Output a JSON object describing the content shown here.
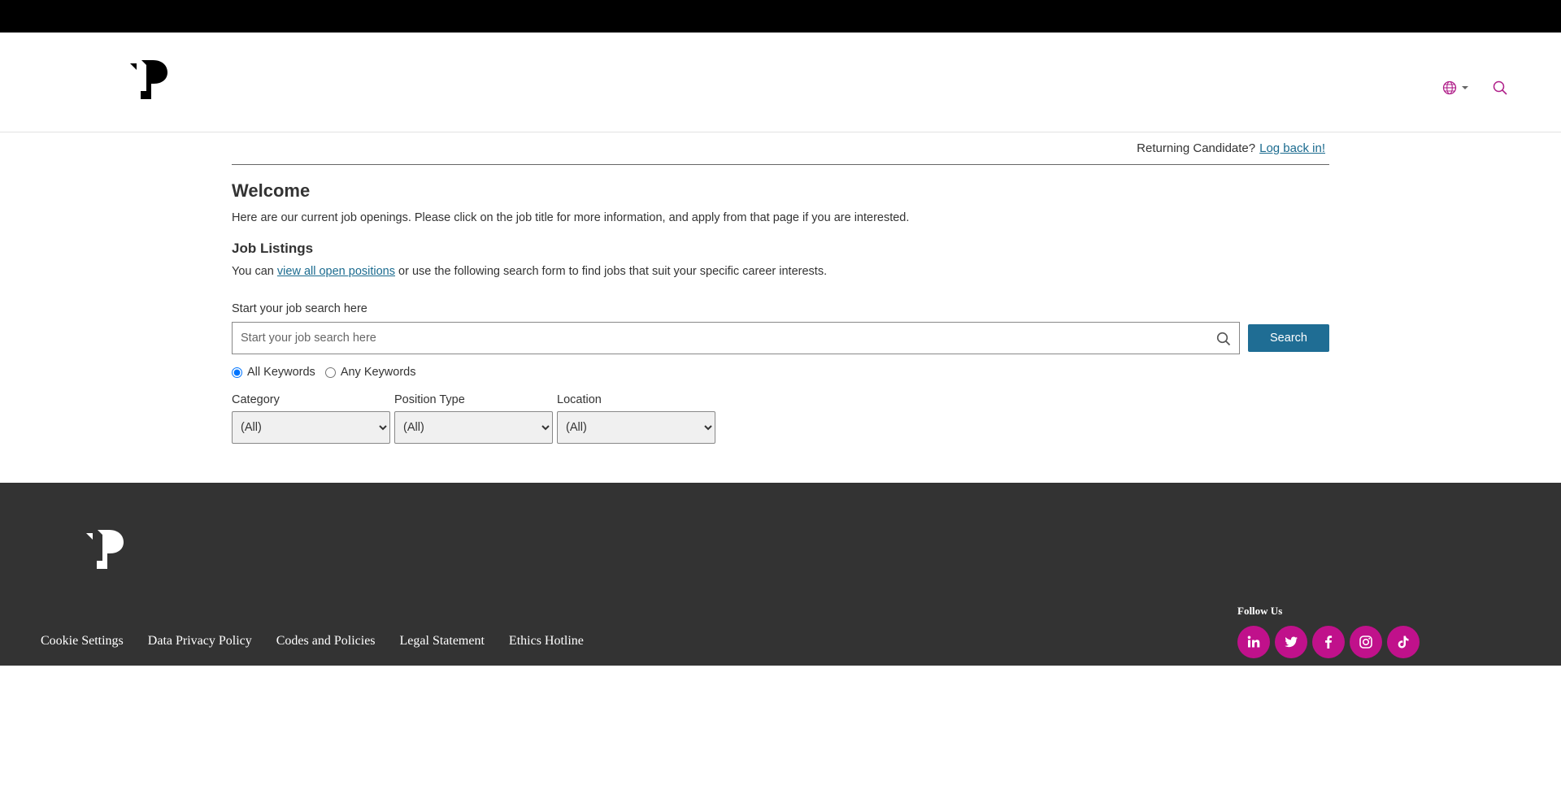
{
  "header": {
    "logo_icon": "p-logo-icon",
    "language_icon": "globe-icon",
    "search_icon": "search-icon"
  },
  "returning": {
    "text": "Returning Candidate?",
    "link": "Log back in!"
  },
  "welcome": {
    "title": "Welcome",
    "intro": "Here are our current job openings. Please click on the job title for more information, and apply from that page if you are interested."
  },
  "listings": {
    "title": "Job Listings",
    "prefix": "You can ",
    "link": "view all open positions",
    "suffix": " or use the following search form to find jobs that suit your specific career interests."
  },
  "search": {
    "label": "Start your job search here",
    "placeholder": "Start your job search here",
    "value": "",
    "button": "Search",
    "radio_all": "All Keywords",
    "radio_any": "Any Keywords",
    "selected": "all"
  },
  "filters": [
    {
      "label": "Category",
      "value": "(All)"
    },
    {
      "label": "Position Type",
      "value": "(All)"
    },
    {
      "label": "Location",
      "value": "(All)"
    }
  ],
  "footer": {
    "links": [
      "Cookie Settings",
      "Data Privacy Policy",
      "Codes and Policies",
      "Legal Statement",
      "Ethics Hotline"
    ],
    "follow_title": "Follow Us",
    "socials": [
      "linkedin-icon",
      "twitter-icon",
      "facebook-icon",
      "instagram-icon",
      "tiktok-icon"
    ]
  },
  "colors": {
    "accent": "#1f6d94",
    "link": "#1b6b8f",
    "social": "#c0118b",
    "footer_bg": "#333333",
    "topbar": "#000000"
  }
}
